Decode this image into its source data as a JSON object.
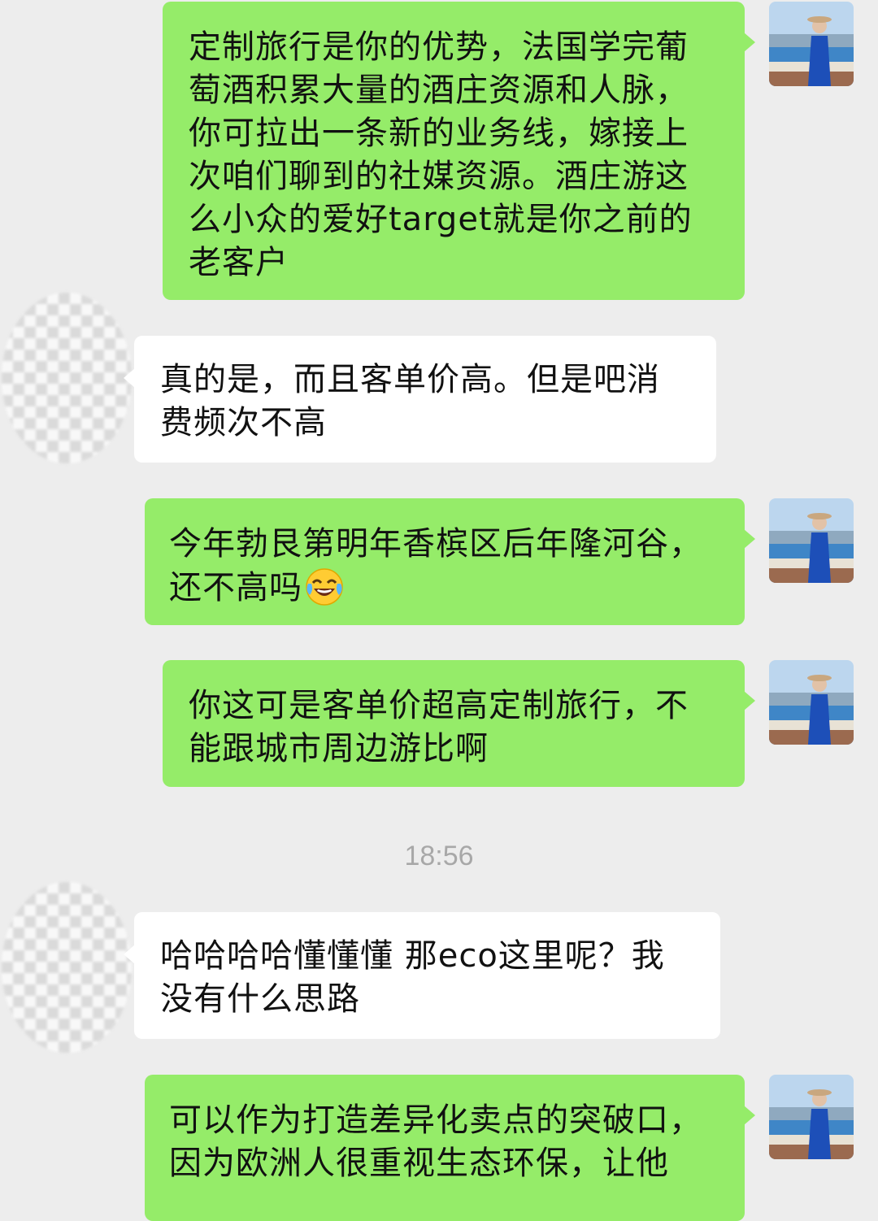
{
  "chat": {
    "messages": [
      {
        "direction": "out",
        "text": "定制旅行是你的优势，法国学完葡萄酒积累大量的酒庄资源和人脉，你可拉出一条新的业务线，嫁接上次咱们聊到的社媒资源。酒庄游这么小众的爱好target就是你之前的老客户"
      },
      {
        "direction": "in",
        "text": "真的是，而且客单价高。但是吧消费频次不高"
      },
      {
        "direction": "out",
        "text": "今年勃艮第明年香槟区后年隆河谷，还不高吗"
      },
      {
        "direction": "out",
        "text": "你这可是客单价超高定制旅行，不能跟城市周边游比啊"
      },
      {
        "direction": "in",
        "text": "哈哈哈哈懂懂懂 那eco这里呢？我没有什么思路"
      },
      {
        "direction": "out",
        "text": "可以作为打造差异化卖点的突破口，因为欧洲人很重视生态环保，让他"
      }
    ],
    "timestamp": "18:56",
    "emoji": "face-with-tears-of-joy-icon"
  },
  "colors": {
    "background": "#ededed",
    "outgoing_bubble": "#95ec69",
    "incoming_bubble": "#ffffff",
    "timestamp_text": "#a8a8a8"
  }
}
